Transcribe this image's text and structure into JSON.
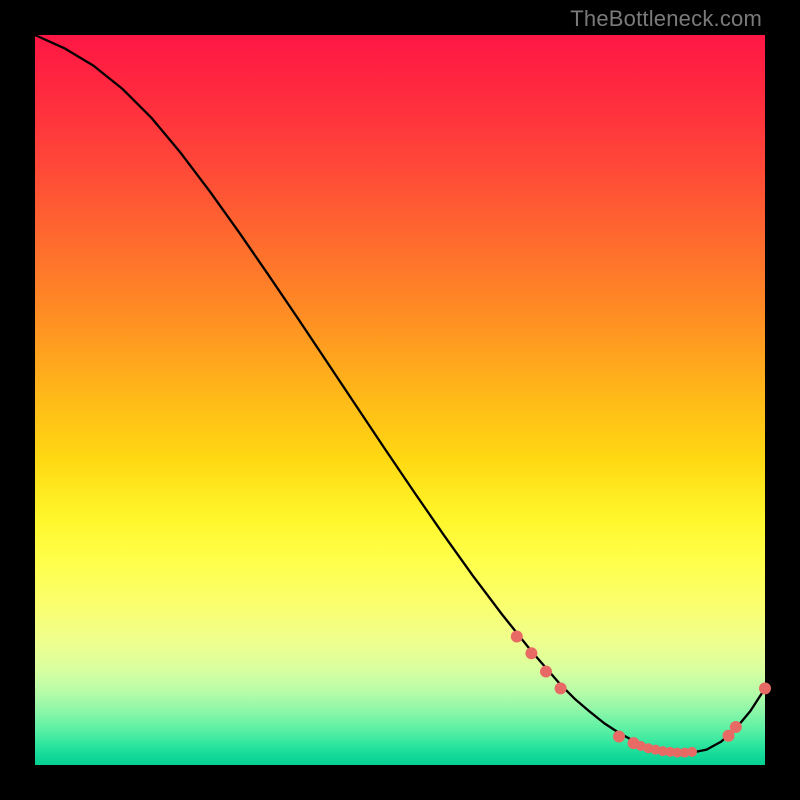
{
  "watermark": "TheBottleneck.com",
  "colors": {
    "marker": "#e86a64",
    "line": "#000000",
    "frame": "#000000"
  },
  "chart_data": {
    "type": "line",
    "title": "",
    "xlabel": "",
    "ylabel": "",
    "xlim": [
      0,
      100
    ],
    "ylim": [
      0,
      100
    ],
    "grid": false,
    "legend": false,
    "series": [
      {
        "name": "curve",
        "x": [
          0,
          4,
          8,
          12,
          16,
          20,
          24,
          28,
          32,
          36,
          40,
          44,
          48,
          52,
          56,
          60,
          64,
          68,
          72,
          74,
          76,
          78,
          80,
          82,
          84,
          86,
          88,
          90,
          92,
          94,
          96,
          98,
          100
        ],
        "y": [
          100,
          98.2,
          95.8,
          92.6,
          88.6,
          83.8,
          78.5,
          72.9,
          67.1,
          61.2,
          55.2,
          49.2,
          43.2,
          37.3,
          31.5,
          25.9,
          20.6,
          15.6,
          11.0,
          9.0,
          7.3,
          5.7,
          4.4,
          3.3,
          2.5,
          2.0,
          1.7,
          1.7,
          2.1,
          3.2,
          5.0,
          7.4,
          10.5
        ]
      }
    ],
    "markers": [
      {
        "x": 66,
        "y": 17.6,
        "r": 6
      },
      {
        "x": 68,
        "y": 15.3,
        "r": 6
      },
      {
        "x": 70,
        "y": 12.8,
        "r": 6
      },
      {
        "x": 72,
        "y": 10.5,
        "r": 6
      },
      {
        "x": 80,
        "y": 3.9,
        "r": 6
      },
      {
        "x": 82,
        "y": 3.0,
        "r": 6
      },
      {
        "x": 83,
        "y": 2.6,
        "r": 5
      },
      {
        "x": 84,
        "y": 2.3,
        "r": 5
      },
      {
        "x": 85,
        "y": 2.1,
        "r": 5
      },
      {
        "x": 86,
        "y": 1.9,
        "r": 5
      },
      {
        "x": 87,
        "y": 1.8,
        "r": 5
      },
      {
        "x": 88,
        "y": 1.7,
        "r": 5
      },
      {
        "x": 89,
        "y": 1.7,
        "r": 5
      },
      {
        "x": 90,
        "y": 1.8,
        "r": 5
      },
      {
        "x": 95,
        "y": 4.0,
        "r": 6
      },
      {
        "x": 96,
        "y": 5.2,
        "r": 6
      },
      {
        "x": 100,
        "y": 10.5,
        "r": 6
      }
    ]
  }
}
